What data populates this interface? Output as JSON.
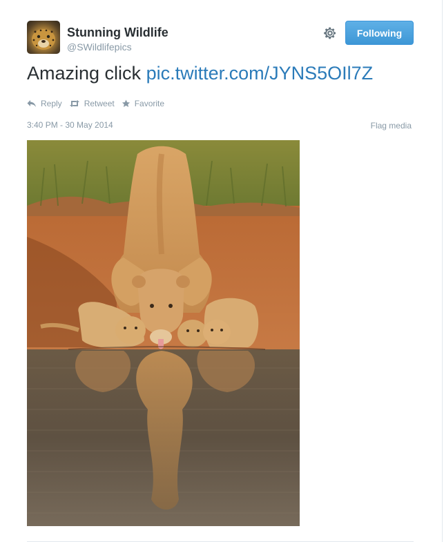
{
  "user": {
    "display_name": "Stunning Wildlife",
    "screen_name": "@SWildlifepics",
    "avatar_icon": "leopard-avatar"
  },
  "controls": {
    "settings_icon": "gear-icon",
    "follow_label": "Following"
  },
  "tweet": {
    "text": "Amazing click",
    "link": "pic.twitter.com/JYNS5OIl7Z"
  },
  "actions": [
    {
      "label": "Reply",
      "icon": "reply-icon"
    },
    {
      "label": "Retweet",
      "icon": "retweet-icon"
    },
    {
      "label": "Favorite",
      "icon": "star-icon"
    }
  ],
  "meta": {
    "timestamp": "3:40 PM - 30 May 2014",
    "flag_label": "Flag media"
  },
  "media": {
    "subject": "lioness-and-cubs-drinking-photo"
  },
  "colors": {
    "link": "#2b7bb9",
    "button": "#4aa3df",
    "muted": "#8899a6"
  }
}
